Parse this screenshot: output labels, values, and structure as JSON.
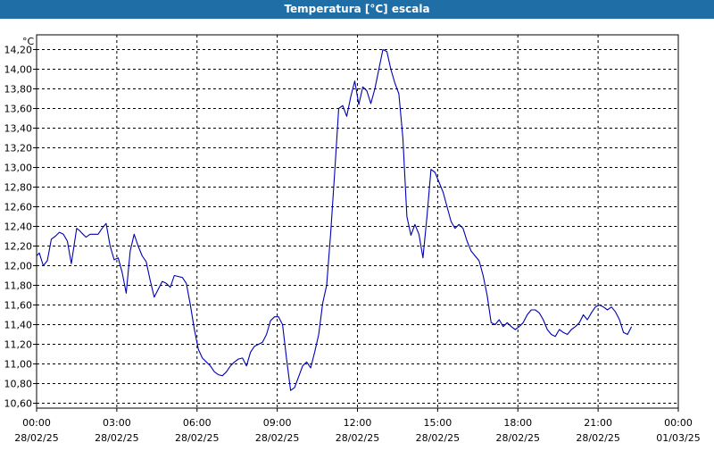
{
  "window": {
    "title": "Temperatura [°C] escala"
  },
  "colors": {
    "title_bar": "#1f6fa6",
    "line": "#0000b4",
    "grid": "#000000",
    "background": "#ffffff"
  },
  "chart_data": {
    "type": "line",
    "title": "Temperatura [°C] escala",
    "ylabel": "°C",
    "xlabel": "",
    "ylim": [
      10.55,
      14.35
    ],
    "y_ticks": [
      "10,60",
      "10,80",
      "11,00",
      "11,20",
      "11,40",
      "11,60",
      "11,80",
      "12,00",
      "12,20",
      "12,40",
      "12,60",
      "12,80",
      "13,00",
      "13,20",
      "13,40",
      "13,60",
      "13,80",
      "14,00",
      "14,20"
    ],
    "x_ticks": [
      {
        "time": "00:00",
        "date": "28/02/25"
      },
      {
        "time": "03:00",
        "date": "28/02/25"
      },
      {
        "time": "06:00",
        "date": "28/02/25"
      },
      {
        "time": "09:00",
        "date": "28/02/25"
      },
      {
        "time": "12:00",
        "date": "28/02/25"
      },
      {
        "time": "15:00",
        "date": "28/02/25"
      },
      {
        "time": "18:00",
        "date": "28/02/25"
      },
      {
        "time": "21:00",
        "date": "28/02/25"
      },
      {
        "time": "00:00",
        "date": "01/03/25"
      }
    ],
    "grid": true,
    "series": [
      {
        "color": "#0000b4",
        "x_hours": [
          0,
          0.1,
          0.25,
          0.4,
          0.55,
          0.7,
          0.85,
          1.0,
          1.15,
          1.3,
          1.5,
          1.6,
          1.7,
          1.85,
          2.0,
          2.15,
          2.3,
          2.45,
          2.6,
          2.75,
          2.9,
          3.05,
          3.2,
          3.35,
          3.5,
          3.65,
          3.8,
          3.95,
          4.1,
          4.25,
          4.4,
          4.55,
          4.7,
          4.85,
          5.0,
          5.15,
          5.3,
          5.45,
          5.6,
          5.75,
          5.9,
          6.05,
          6.2,
          6.35,
          6.5,
          6.65,
          6.8,
          6.95,
          7.1,
          7.25,
          7.4,
          7.55,
          7.7,
          7.85,
          8.0,
          8.15,
          8.3,
          8.45,
          8.6,
          8.75,
          8.9,
          9.05,
          9.2,
          9.35,
          9.5,
          9.65,
          9.8,
          9.95,
          10.1,
          10.25,
          10.4,
          10.55,
          10.7,
          10.85,
          11.0,
          11.15,
          11.3,
          11.45,
          11.6,
          11.75,
          11.9,
          12.05,
          12.2,
          12.35,
          12.5,
          12.65,
          12.8,
          12.95,
          13.1,
          13.25,
          13.4,
          13.55,
          13.7,
          13.85,
          14.0,
          14.15,
          14.3,
          14.45,
          14.6,
          14.75,
          14.9,
          15.05,
          15.2,
          15.35,
          15.5,
          15.65,
          15.8,
          15.95,
          16.1,
          16.25,
          16.4,
          16.55,
          16.7,
          16.85,
          17.0,
          17.15,
          17.3,
          17.45,
          17.6,
          17.75,
          17.9,
          18.05,
          18.2,
          18.35,
          18.5,
          18.65,
          18.8,
          18.95,
          19.1,
          19.25,
          19.4,
          19.55,
          19.7,
          19.85,
          20.0,
          20.15,
          20.3,
          20.45,
          20.6,
          20.75,
          20.9,
          21.05,
          21.2,
          21.35,
          21.5,
          21.65,
          21.8,
          21.95,
          22.1,
          22.25,
          22.4,
          22.55,
          22.7,
          22.85,
          23.0,
          23.15,
          23.3,
          23.45,
          23.6,
          23.75,
          23.9
        ],
        "y": [
          12.1,
          12.13,
          12.0,
          12.05,
          12.27,
          12.3,
          12.34,
          12.32,
          12.25,
          12.02,
          12.38,
          12.36,
          12.33,
          12.29,
          12.32,
          12.32,
          12.32,
          12.38,
          12.43,
          12.2,
          12.06,
          12.08,
          11.93,
          11.72,
          12.15,
          12.32,
          12.2,
          12.1,
          12.04,
          11.85,
          11.68,
          11.76,
          11.84,
          11.82,
          11.78,
          11.9,
          11.89,
          11.88,
          11.82,
          11.6,
          11.35,
          11.15,
          11.06,
          11.02,
          10.98,
          10.92,
          10.89,
          10.88,
          10.92,
          10.98,
          11.02,
          11.05,
          11.06,
          10.98,
          11.12,
          11.18,
          11.2,
          11.22,
          11.3,
          11.44,
          11.48,
          11.48,
          11.4,
          11.05,
          10.73,
          10.76,
          10.87,
          10.98,
          11.02,
          10.96,
          11.12,
          11.3,
          11.62,
          11.8,
          12.33,
          12.95,
          13.6,
          13.63,
          13.52,
          13.72,
          13.88,
          13.64,
          13.82,
          13.78,
          13.65,
          13.8,
          14.0,
          14.2,
          14.18,
          14.0,
          13.86,
          13.75,
          13.3,
          12.5,
          12.31,
          12.42,
          12.32,
          12.08,
          12.5,
          12.98,
          12.95,
          12.85,
          12.75,
          12.6,
          12.45,
          12.38,
          12.42,
          12.38,
          12.25,
          12.15,
          12.1,
          12.05,
          11.9,
          11.7,
          11.42,
          11.4,
          11.45,
          11.38,
          11.42,
          11.38,
          11.35,
          11.38,
          11.42,
          11.5,
          11.55,
          11.55,
          11.52,
          11.45,
          11.35,
          11.3,
          11.28,
          11.35,
          11.32,
          11.3,
          11.35,
          11.38,
          11.42,
          11.5,
          11.45,
          11.52,
          11.58,
          11.6,
          11.58,
          11.55,
          11.58,
          11.53,
          11.45,
          11.32,
          11.3,
          11.38
        ]
      }
    ]
  }
}
